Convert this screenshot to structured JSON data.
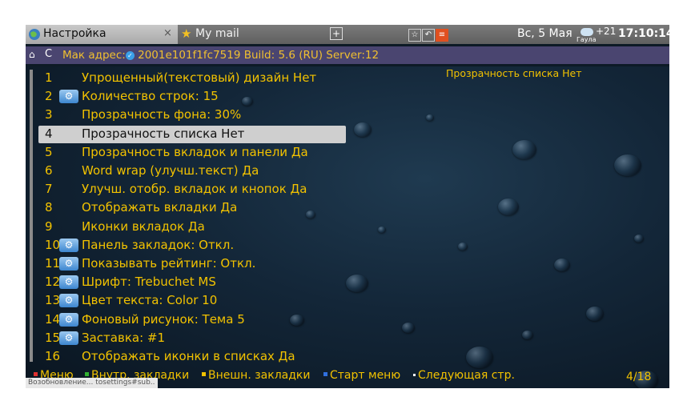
{
  "tabs": [
    {
      "title": "Настройка",
      "icon": "globe-icon",
      "close": "×"
    },
    {
      "title": "My mail",
      "icon": "star-icon"
    }
  ],
  "tabbar": {
    "new_tab": "+",
    "date": "Вс, 5 Мая",
    "weather_city": "Гаула",
    "temperature": "+21",
    "time": "17:10:14"
  },
  "address": {
    "text": "Мак адрес: 2001e101f1fc7519 Build: 5.6 (RU) Server:12",
    "prefix": "Мак адрес:",
    "suffix": "2001e101f1fc7519 Build: 5.6 (RU) Server:12"
  },
  "settings": [
    {
      "num": "1",
      "label": "Упрощенный(текстовый) дизайн Нет",
      "gear": false
    },
    {
      "num": "2",
      "label": "Количество строк: 15",
      "gear": true
    },
    {
      "num": "3",
      "label": "Прозрачность фона: 30%",
      "gear": false
    },
    {
      "num": "4",
      "label": "Прозрачность списка Нет",
      "gear": false
    },
    {
      "num": "5",
      "label": "Прозрачность вкладок и панели Да",
      "gear": false
    },
    {
      "num": "6",
      "label": "Word wrap (улучш.текст) Да",
      "gear": false
    },
    {
      "num": "7",
      "label": "Улучш. отобр. вкладок и кнопок Да",
      "gear": false
    },
    {
      "num": "8",
      "label": "Отображать вкладки Да",
      "gear": false
    },
    {
      "num": "9",
      "label": "Иконки вкладок Да",
      "gear": false
    },
    {
      "num": "10",
      "label": "Панель закладок: Откл.",
      "gear": true
    },
    {
      "num": "11",
      "label": "Показывать рейтинг: Откл.",
      "gear": true
    },
    {
      "num": "12",
      "label": "Шрифт: Trebuchet MS",
      "gear": true
    },
    {
      "num": "13",
      "label": "Цвет текста: Color 10",
      "gear": true
    },
    {
      "num": "14",
      "label": "Фоновый рисунок: Тема 5",
      "gear": true
    },
    {
      "num": "15",
      "label": "Заставка: #1",
      "gear": true
    },
    {
      "num": "16",
      "label": "Отображать иконки в списках Да",
      "gear": false
    }
  ],
  "selected_index": 3,
  "preview_text": "Прозрачность списка Нет",
  "bottom": {
    "menu": "Меню",
    "internal_bookmarks": "Внутр. закладки",
    "external_bookmarks": "Внешн. закладки",
    "start_menu": "Старт меню",
    "next_page": "Следующая стр.",
    "page_counter": "4/18"
  },
  "status_text": "Возобновление... tosettings#sub..",
  "colors": {
    "accent": "#f2c200",
    "address_bg": "#4a4570",
    "selected_bg": "#cfcfcf",
    "red": "#e03030",
    "green": "#30b030",
    "yellow": "#f2c200",
    "blue": "#3070e0"
  }
}
